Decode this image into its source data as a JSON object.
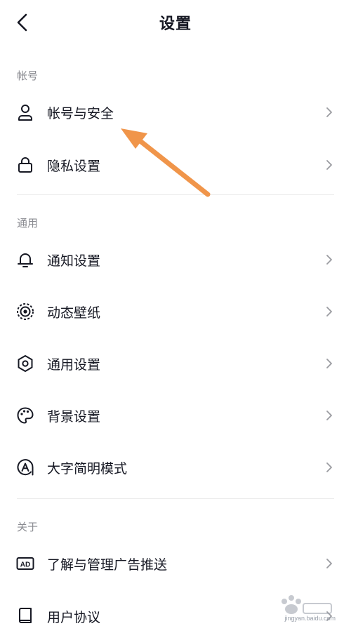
{
  "header": {
    "title": "设置",
    "back_icon": "chevron-left-icon"
  },
  "sections": [
    {
      "title": "帐号",
      "items": [
        {
          "label": "帐号与安全",
          "icon": "user-icon"
        },
        {
          "label": "隐私设置",
          "icon": "lock-icon"
        }
      ]
    },
    {
      "title": "通用",
      "items": [
        {
          "label": "通知设置",
          "icon": "bell-icon"
        },
        {
          "label": "动态壁纸",
          "icon": "live-wallpaper-icon"
        },
        {
          "label": "通用设置",
          "icon": "gear-icon"
        },
        {
          "label": "背景设置",
          "icon": "palette-icon"
        },
        {
          "label": "大字简明模式",
          "icon": "large-text-icon"
        }
      ]
    },
    {
      "title": "关于",
      "items": [
        {
          "label": "了解与管理广告推送",
          "icon": "ad-icon"
        },
        {
          "label": "用户协议",
          "icon": "book-icon"
        }
      ]
    }
  ],
  "annotation": {
    "arrow_color": "#f0954a"
  },
  "watermark": {
    "text": "jingyan.baidu.com",
    "logo": "baidu-jingyan-logo"
  }
}
